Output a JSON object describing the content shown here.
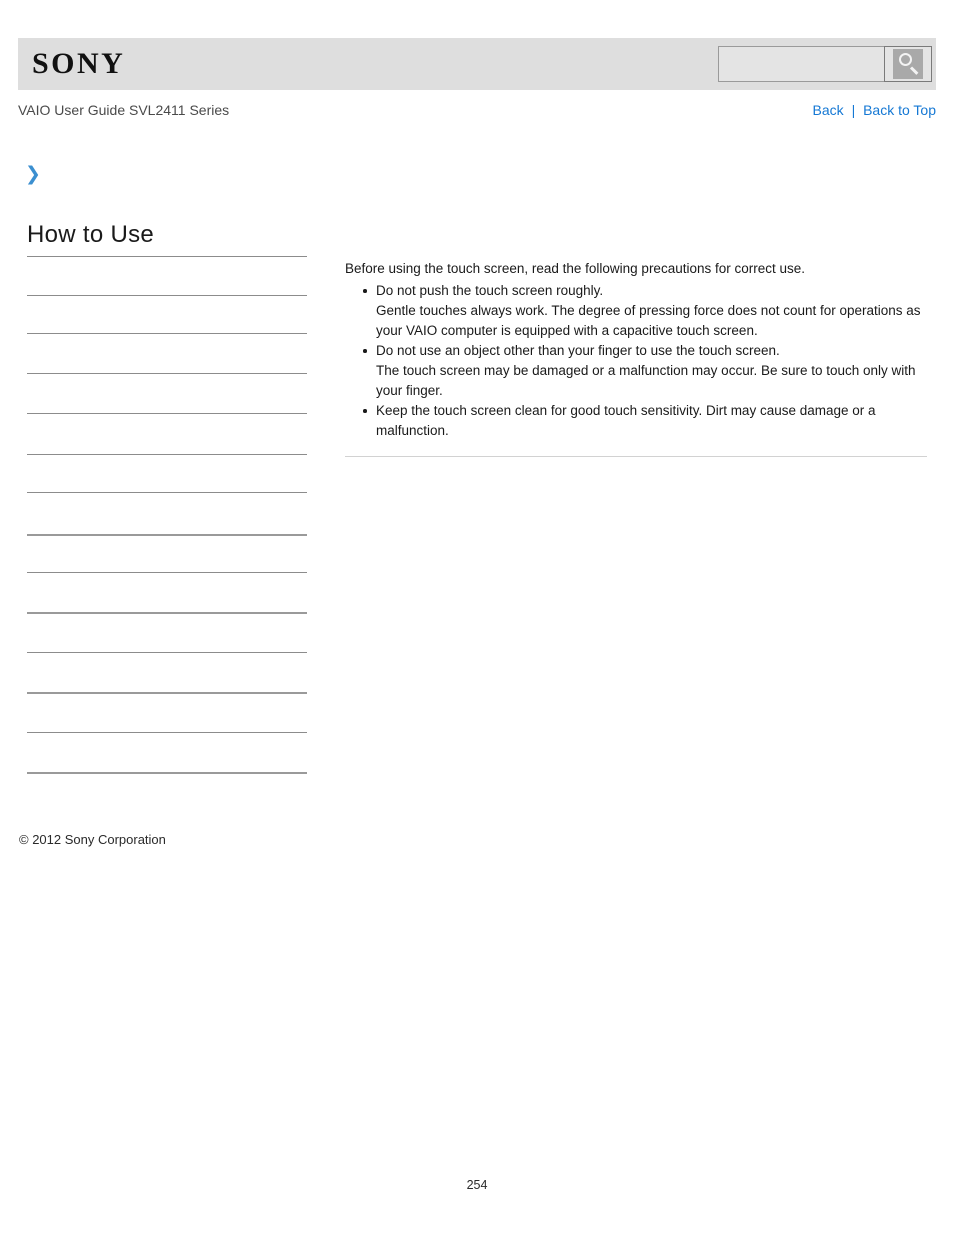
{
  "header": {
    "logo_text": "SONY",
    "search": {
      "value": "",
      "placeholder": "",
      "icon": "search-icon",
      "button_label": ""
    }
  },
  "title_bar": {
    "guide_title": "VAIO User Guide SVL2411 Series",
    "links": {
      "back": "Back",
      "separator": "|",
      "back_to_top": "Back to Top"
    },
    "link_color": "#1578d4"
  },
  "marker": {
    "icon": "chevron-right-icon",
    "glyph": "❯",
    "color": "#3b8fd0"
  },
  "sidebar": {
    "heading": "How to Use",
    "items": [
      {
        "label": "",
        "rule": "thin"
      },
      {
        "label": "",
        "rule": "thin"
      },
      {
        "label": "",
        "rule": "thin"
      },
      {
        "label": "",
        "rule": "thin"
      },
      {
        "label": "",
        "rule": "thin"
      },
      {
        "label": "",
        "rule": "thin"
      },
      {
        "label": "",
        "rule": "thin"
      },
      {
        "label": "",
        "rule": "thick"
      },
      {
        "label": "",
        "rule": "thin"
      },
      {
        "label": "",
        "rule": "thick"
      },
      {
        "label": "",
        "rule": "thin"
      },
      {
        "label": "",
        "rule": "thick"
      },
      {
        "label": "",
        "rule": "thin"
      },
      {
        "label": "",
        "rule": "thick"
      }
    ]
  },
  "content": {
    "intro": "Before using the touch screen, read the following precautions for correct use.",
    "items": [
      {
        "head": "Do not push the touch screen roughly.",
        "body": "Gentle touches always work. The degree of pressing force does not count for operations as your VAIO computer is equipped with a capacitive touch screen."
      },
      {
        "head": "Do not use an object other than your finger to use the touch screen.",
        "body": "The touch screen may be damaged or a malfunction may occur. Be sure to touch only with your finger."
      },
      {
        "head": "Keep the touch screen clean for good touch sensitivity. Dirt may cause damage or a malfunction.",
        "body": ""
      }
    ]
  },
  "footer": {
    "copyright": "© 2012 Sony Corporation",
    "page_number": "254"
  }
}
